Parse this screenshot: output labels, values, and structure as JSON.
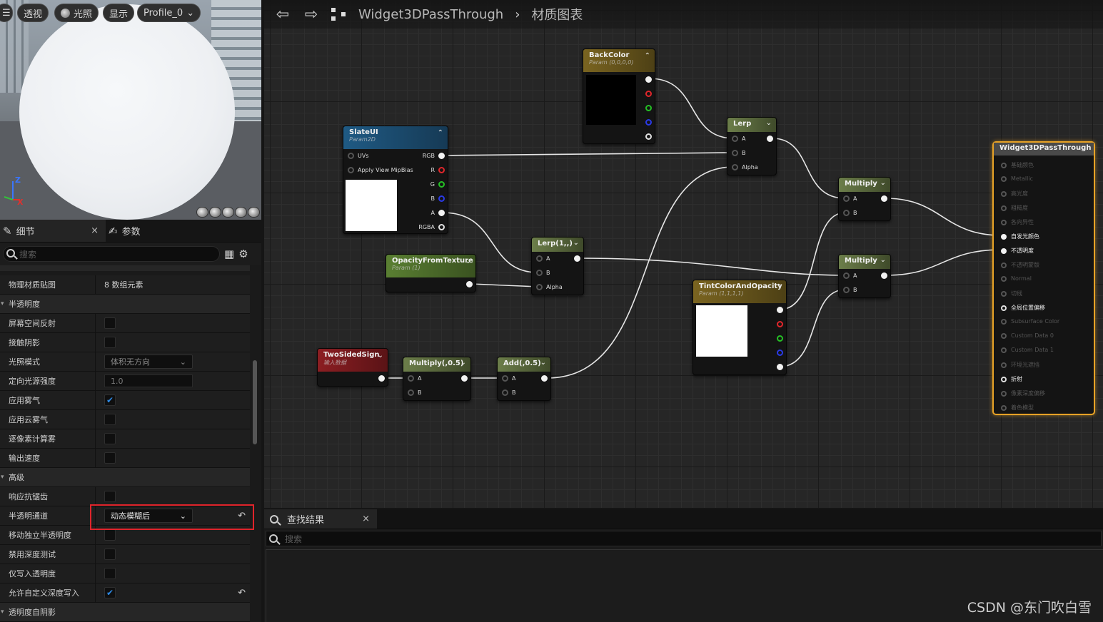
{
  "viewport": {
    "buttons": {
      "menu": "☰",
      "perspective": "透视",
      "lit": "光照",
      "show": "显示",
      "profile": "Profile_0"
    },
    "axes": {
      "z": "Z",
      "x": "X"
    },
    "colors": {
      "z": "#3a76ff",
      "x": "#e0312e",
      "y": "#33c33a"
    }
  },
  "details": {
    "tab_details": "细节",
    "tab_params": "参数",
    "close": "×",
    "search_placeholder": "搜索",
    "rows": [
      {
        "label": "物理材质贴图",
        "type": "text",
        "value": "8 数组元素"
      },
      {
        "label": "半透明度",
        "type": "category"
      },
      {
        "label": "屏幕空间反射",
        "type": "check",
        "checked": false
      },
      {
        "label": "接触阴影",
        "type": "check",
        "checked": false
      },
      {
        "label": "光照模式",
        "type": "dropdown",
        "value": "体积无方向"
      },
      {
        "label": "定向光源强度",
        "type": "number",
        "value": "1.0"
      },
      {
        "label": "应用雾气",
        "type": "check",
        "checked": true
      },
      {
        "label": "应用云雾气",
        "type": "check",
        "checked": false
      },
      {
        "label": "逐像素计算雾",
        "type": "check",
        "checked": false
      },
      {
        "label": "输出速度",
        "type": "check",
        "checked": false
      },
      {
        "label": "高级",
        "type": "category"
      },
      {
        "label": "响应抗锯齿",
        "type": "check",
        "checked": false
      },
      {
        "label": "半透明通道",
        "type": "dropdown",
        "value": "动态模糊后",
        "active": true,
        "reset": true
      },
      {
        "label": "移动独立半透明度",
        "type": "check",
        "checked": false
      },
      {
        "label": "禁用深度测试",
        "type": "check",
        "checked": false
      },
      {
        "label": "仅写入透明度",
        "type": "check",
        "checked": false
      },
      {
        "label": "允许自定义深度写入",
        "type": "check",
        "checked": true,
        "reset": true
      },
      {
        "label": "透明度自阴影",
        "type": "category"
      }
    ]
  },
  "graph": {
    "breadcrumb_asset": "Widget3DPassThrough",
    "breadcrumb_sep": "›",
    "breadcrumb_graph": "材质图表",
    "nodes": {
      "backcolor": {
        "title": "BackColor",
        "subtitle": "Param (0,0,0,0)"
      },
      "slateui": {
        "title": "SlateUI",
        "subtitle": "Param2D",
        "pin_uvs": "UVs",
        "pin_mip": "Apply View MipBias",
        "out_rgb": "RGB",
        "out_r": "R",
        "out_g": "G",
        "out_b": "B",
        "out_a": "A",
        "out_rgba": "RGBA"
      },
      "lerp": {
        "title": "Lerp",
        "a": "A",
        "b": "B",
        "alpha": "Alpha"
      },
      "lerp2": {
        "title": "Lerp(1,,)",
        "a": "A",
        "b": "B",
        "alpha": "Alpha"
      },
      "opacity": {
        "title": "OpacityFromTexture",
        "subtitle": "Param (1)"
      },
      "mult1": {
        "title": "Multiply",
        "a": "A",
        "b": "B"
      },
      "mult2": {
        "title": "Multiply",
        "a": "A",
        "b": "B"
      },
      "tint": {
        "title": "TintColorAndOpacity",
        "subtitle": "Param (1,1,1,1)"
      },
      "twosided": {
        "title": "TwoSidedSign",
        "subtitle": "输入数据"
      },
      "mult05": {
        "title": "Multiply(,0.5)",
        "a": "A",
        "b": "B"
      },
      "add05": {
        "title": "Add(,0.5)",
        "a": "A",
        "b": "B"
      }
    },
    "output": {
      "title": "Widget3DPassThrough",
      "pins": [
        {
          "label": "基础颜色",
          "on": false
        },
        {
          "label": "Metallic",
          "on": false
        },
        {
          "label": "高光度",
          "on": false
        },
        {
          "label": "粗糙度",
          "on": false
        },
        {
          "label": "各向异性",
          "on": false
        },
        {
          "label": "自发光颜色",
          "on": true,
          "filled": true
        },
        {
          "label": "不透明度",
          "on": true,
          "filled": true
        },
        {
          "label": "不透明蒙版",
          "on": false
        },
        {
          "label": "Normal",
          "on": false
        },
        {
          "label": "切线",
          "on": false
        },
        {
          "label": "全局位置偏移",
          "on": true
        },
        {
          "label": "Subsurface Color",
          "on": false
        },
        {
          "label": "Custom Data 0",
          "on": false
        },
        {
          "label": "Custom Data 1",
          "on": false
        },
        {
          "label": "环境光遮挡",
          "on": false
        },
        {
          "label": "折射",
          "on": true
        },
        {
          "label": "像素深度偏移",
          "on": false
        },
        {
          "label": "着色模型",
          "on": false
        }
      ]
    }
  },
  "find": {
    "tab_label": "查找结果",
    "close": "×",
    "search_placeholder": "搜索"
  },
  "watermark": "CSDN @东门吹白雪"
}
